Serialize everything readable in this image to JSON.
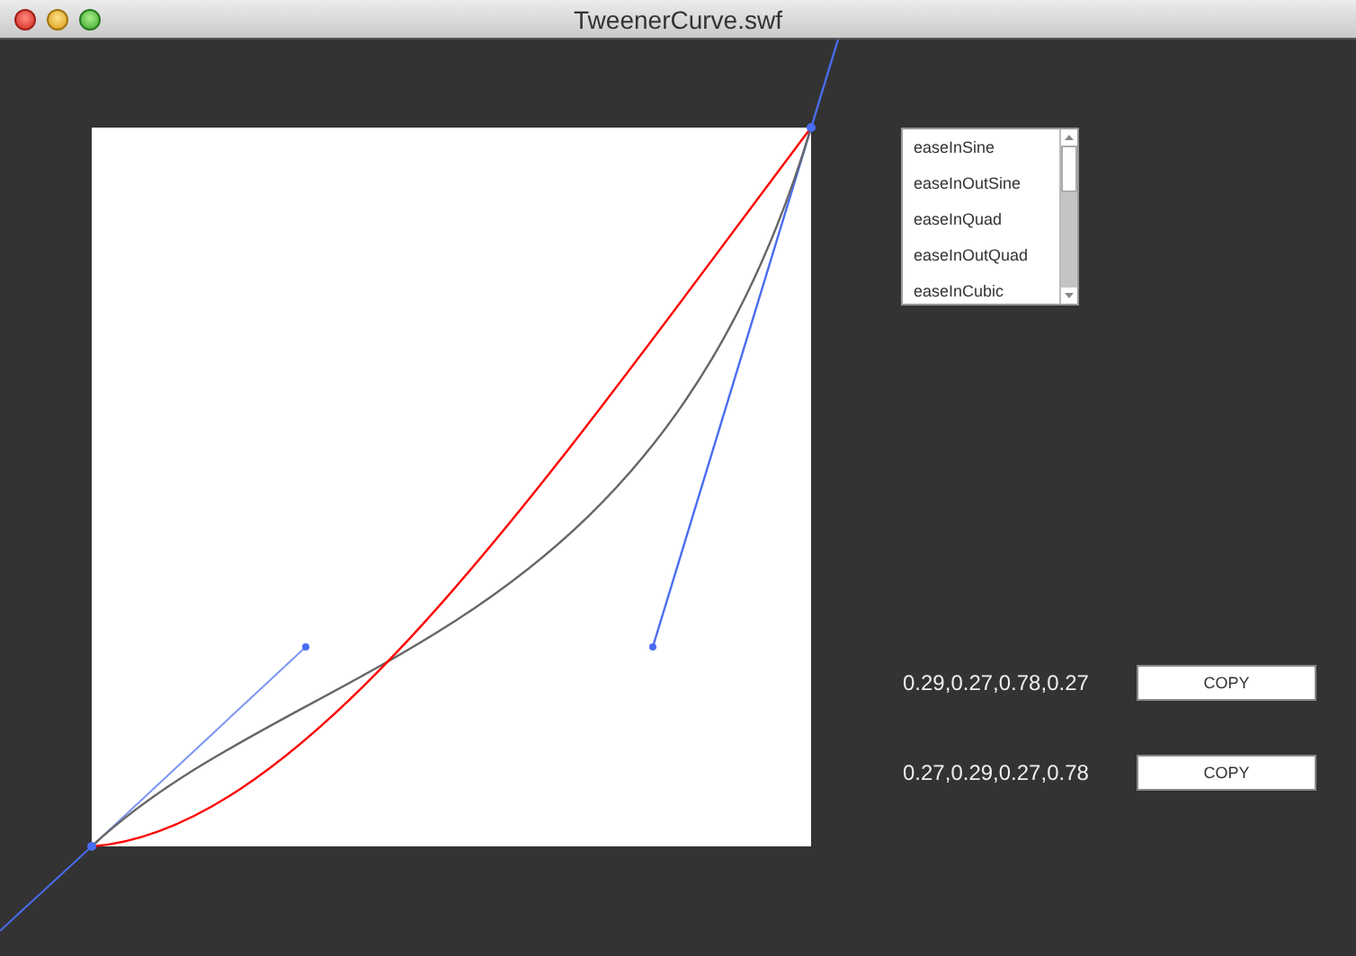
{
  "window": {
    "title": "TweenerCurve.swf"
  },
  "ease_list": {
    "items": [
      "easeInSine",
      "easeInOutSine",
      "easeInQuad",
      "easeInOutQuad",
      "easeInCubic"
    ]
  },
  "outputs": [
    {
      "value": "0.29,0.27,0.78,0.27",
      "button": "COPY"
    },
    {
      "value": "0.27,0.29,0.27,0.78",
      "button": "COPY"
    }
  ]
}
